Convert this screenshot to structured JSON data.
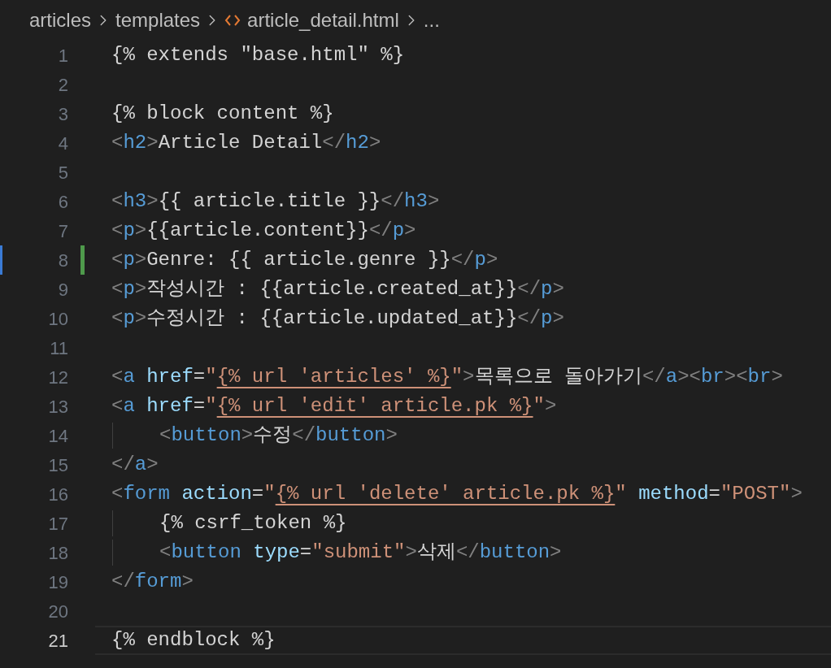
{
  "breadcrumb": [
    {
      "label": "articles",
      "kind": "folder"
    },
    {
      "label": "templates",
      "kind": "folder"
    },
    {
      "label": "article_detail.html",
      "kind": "file"
    },
    {
      "label": "...",
      "kind": "more"
    }
  ],
  "lines": [
    {
      "number": "1",
      "tokens": [
        {
          "kind": "text",
          "text": "{% extends \"base.html\" %}"
        }
      ]
    },
    {
      "number": "2"
    },
    {
      "number": "3",
      "tokens": [
        {
          "kind": "text",
          "text": "{% block content %}"
        }
      ]
    },
    {
      "number": "4",
      "tokens": [
        {
          "kind": "punct",
          "text": "<"
        },
        {
          "kind": "tag",
          "text": "h2"
        },
        {
          "kind": "punct",
          "text": ">"
        },
        {
          "kind": "text",
          "text": "Article Detail"
        },
        {
          "kind": "punct",
          "text": "</"
        },
        {
          "kind": "tag",
          "text": "h2"
        },
        {
          "kind": "punct",
          "text": ">"
        }
      ]
    },
    {
      "number": "5"
    },
    {
      "number": "6",
      "tokens": [
        {
          "kind": "punct",
          "text": "<"
        },
        {
          "kind": "tag",
          "text": "h3"
        },
        {
          "kind": "punct",
          "text": ">"
        },
        {
          "kind": "text",
          "text": "{{ article.title }}"
        },
        {
          "kind": "punct",
          "text": "</"
        },
        {
          "kind": "tag",
          "text": "h3"
        },
        {
          "kind": "punct",
          "text": ">"
        }
      ]
    },
    {
      "number": "7",
      "tokens": [
        {
          "kind": "punct",
          "text": "<"
        },
        {
          "kind": "tag",
          "text": "p"
        },
        {
          "kind": "punct",
          "text": ">"
        },
        {
          "kind": "text",
          "text": "{{article.content}}"
        },
        {
          "kind": "punct",
          "text": "</"
        },
        {
          "kind": "tag",
          "text": "p"
        },
        {
          "kind": "punct",
          "text": ">"
        }
      ]
    },
    {
      "number": "8",
      "modified": true,
      "tokens": [
        {
          "kind": "punct",
          "text": "<"
        },
        {
          "kind": "tag",
          "text": "p"
        },
        {
          "kind": "punct",
          "text": ">"
        },
        {
          "kind": "text",
          "text": "Genre: {{ article.genre }}"
        },
        {
          "kind": "punct",
          "text": "</"
        },
        {
          "kind": "tag",
          "text": "p"
        },
        {
          "kind": "punct",
          "text": ">"
        }
      ]
    },
    {
      "number": "9",
      "tokens": [
        {
          "kind": "punct",
          "text": "<"
        },
        {
          "kind": "tag",
          "text": "p"
        },
        {
          "kind": "punct",
          "text": ">"
        },
        {
          "kind": "text",
          "text": "작성시간 : {{article.created_at}}"
        },
        {
          "kind": "punct",
          "text": "</"
        },
        {
          "kind": "tag",
          "text": "p"
        },
        {
          "kind": "punct",
          "text": ">"
        }
      ]
    },
    {
      "number": "10",
      "tokens": [
        {
          "kind": "punct",
          "text": "<"
        },
        {
          "kind": "tag",
          "text": "p"
        },
        {
          "kind": "punct",
          "text": ">"
        },
        {
          "kind": "text",
          "text": "수정시간 : {{article.updated_at}}"
        },
        {
          "kind": "punct",
          "text": "</"
        },
        {
          "kind": "tag",
          "text": "p"
        },
        {
          "kind": "punct",
          "text": ">"
        }
      ]
    },
    {
      "number": "11"
    },
    {
      "number": "12",
      "tokens": [
        {
          "kind": "punct",
          "text": "<"
        },
        {
          "kind": "tag",
          "text": "a"
        },
        {
          "kind": "attr",
          "text": " href"
        },
        {
          "kind": "text",
          "text": "="
        },
        {
          "kind": "string",
          "text": "\""
        },
        {
          "kind": "template",
          "text": "{% url 'articles' %}"
        },
        {
          "kind": "string",
          "text": "\""
        },
        {
          "kind": "punct",
          "text": ">"
        },
        {
          "kind": "text",
          "text": "목록으로 돌아가기"
        },
        {
          "kind": "punct",
          "text": "</"
        },
        {
          "kind": "tag",
          "text": "a"
        },
        {
          "kind": "punct",
          "text": "><"
        },
        {
          "kind": "tag",
          "text": "br"
        },
        {
          "kind": "punct",
          "text": "><"
        },
        {
          "kind": "tag",
          "text": "br"
        },
        {
          "kind": "punct",
          "text": ">"
        }
      ]
    },
    {
      "number": "13",
      "tokens": [
        {
          "kind": "punct",
          "text": "<"
        },
        {
          "kind": "tag",
          "text": "a"
        },
        {
          "kind": "attr",
          "text": " href"
        },
        {
          "kind": "text",
          "text": "="
        },
        {
          "kind": "string",
          "text": "\""
        },
        {
          "kind": "template",
          "text": "{% url 'edit' article.pk %}"
        },
        {
          "kind": "string",
          "text": "\""
        },
        {
          "kind": "punct",
          "text": ">"
        }
      ]
    },
    {
      "number": "14",
      "indented": true,
      "tokens": [
        {
          "kind": "punct",
          "text": "<"
        },
        {
          "kind": "tag",
          "text": "button"
        },
        {
          "kind": "punct",
          "text": ">"
        },
        {
          "kind": "text",
          "text": "수정"
        },
        {
          "kind": "punct",
          "text": "</"
        },
        {
          "kind": "tag",
          "text": "button"
        },
        {
          "kind": "punct",
          "text": ">"
        }
      ]
    },
    {
      "number": "15",
      "tokens": [
        {
          "kind": "punct",
          "text": "</"
        },
        {
          "kind": "tag",
          "text": "a"
        },
        {
          "kind": "punct",
          "text": ">"
        }
      ]
    },
    {
      "number": "16",
      "tokens": [
        {
          "kind": "punct",
          "text": "<"
        },
        {
          "kind": "tag",
          "text": "form"
        },
        {
          "kind": "attr",
          "text": " action"
        },
        {
          "kind": "text",
          "text": "="
        },
        {
          "kind": "string",
          "text": "\""
        },
        {
          "kind": "template",
          "text": "{% url 'delete' article.pk %}"
        },
        {
          "kind": "string",
          "text": "\""
        },
        {
          "kind": "attr",
          "text": " method"
        },
        {
          "kind": "text",
          "text": "="
        },
        {
          "kind": "string",
          "text": "\"POST\""
        },
        {
          "kind": "punct",
          "text": ">"
        }
      ]
    },
    {
      "number": "17",
      "indented": true,
      "tokens": [
        {
          "kind": "text",
          "text": "{% csrf_token %}"
        }
      ]
    },
    {
      "number": "18",
      "indented": true,
      "tokens": [
        {
          "kind": "punct",
          "text": "<"
        },
        {
          "kind": "tag",
          "text": "button"
        },
        {
          "kind": "attr",
          "text": " type"
        },
        {
          "kind": "text",
          "text": "="
        },
        {
          "kind": "string",
          "text": "\"submit\""
        },
        {
          "kind": "punct",
          "text": ">"
        },
        {
          "kind": "text",
          "text": "삭제"
        },
        {
          "kind": "punct",
          "text": "</"
        },
        {
          "kind": "tag",
          "text": "button"
        },
        {
          "kind": "punct",
          "text": ">"
        }
      ]
    },
    {
      "number": "19",
      "tokens": [
        {
          "kind": "punct",
          "text": "</"
        },
        {
          "kind": "tag",
          "text": "form"
        },
        {
          "kind": "punct",
          "text": ">"
        }
      ]
    },
    {
      "number": "20"
    },
    {
      "number": "21",
      "current": true,
      "tokens": [
        {
          "kind": "text",
          "text": "{% endblock %}"
        }
      ]
    }
  ]
}
